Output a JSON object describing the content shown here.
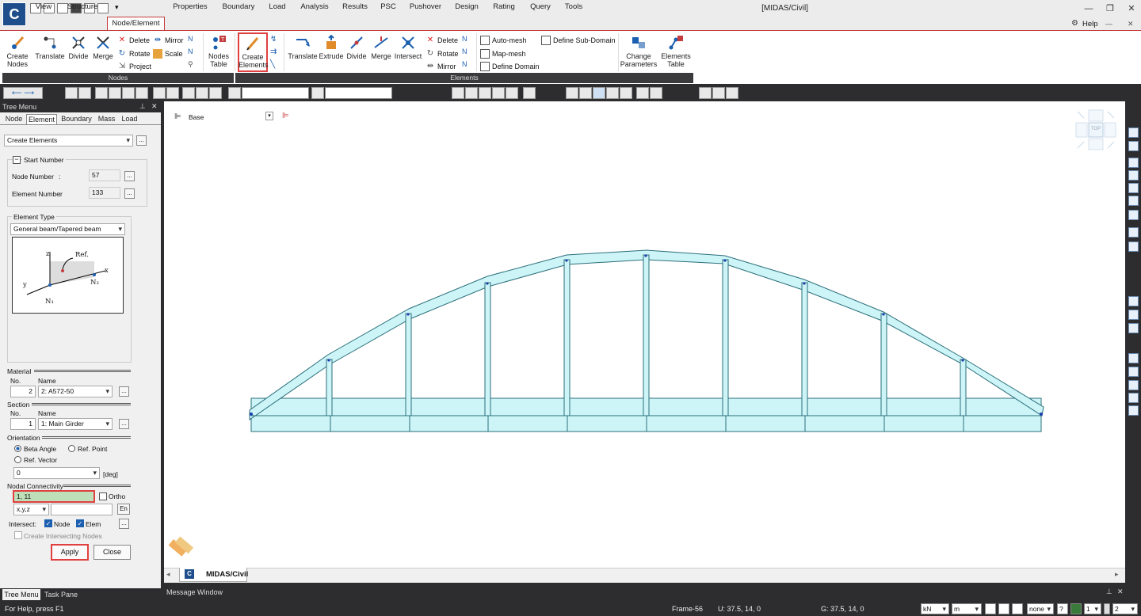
{
  "app": {
    "title": "[MIDAS/Civil]",
    "logo": "C"
  },
  "window": {
    "minimize": "—",
    "restore": "❐",
    "close": "✕"
  },
  "menu": {
    "tabs": [
      "View",
      "Structure",
      "Node/Element",
      "Properties",
      "Boundary",
      "Load",
      "Analysis",
      "Results",
      "PSC",
      "Pushover",
      "Design",
      "Rating",
      "Query",
      "Tools"
    ],
    "active": "Node/Element",
    "help": "Help"
  },
  "ribbon": {
    "nodes_group": "Nodes",
    "elements_group": "Elements",
    "create_nodes": "Create Nodes",
    "translate": "Translate",
    "divide": "Divide",
    "merge": "Merge",
    "delete": "Delete",
    "rotate": "Rotate",
    "project": "Project",
    "mirror": "Mirror",
    "scale": "Scale",
    "nodes_table": "Nodes Table",
    "create_elements": "Create Elements",
    "e_translate": "Translate",
    "extrude": "Extrude",
    "e_divide": "Divide",
    "e_merge": "Merge",
    "intersect": "Intersect",
    "e_delete": "Delete",
    "e_rotate": "Rotate",
    "e_mirror": "Mirror",
    "auto_mesh": "Auto-mesh",
    "map_mesh": "Map-mesh",
    "define_domain": "Define Domain",
    "define_sub_domain": "Define Sub-Domain",
    "change_parameters": "Change Parameters",
    "elements_table": "Elements Table"
  },
  "tree": {
    "header": "Tree Menu",
    "tabs": [
      "Node",
      "Element",
      "Boundary",
      "Mass",
      "Load"
    ],
    "active_tab": "Element",
    "command": "Create Elements",
    "start_number": "Start Number",
    "node_number_label": "Node Number",
    "node_number": "57",
    "element_number_label": "Element Number",
    "element_number": "133",
    "element_type_label": "Element Type",
    "element_type": "General beam/Tapered beam",
    "diagram": {
      "z": "z",
      "ref": "Ref.",
      "x": "x",
      "y": "y",
      "n1": "N₁",
      "n2": "N₂"
    },
    "material_label": "Material",
    "no": "No.",
    "name": "Name",
    "material_no": "2",
    "material_name": "2: A572-50",
    "section_label": "Section",
    "section_no": "1",
    "section_name": "1: Main Girder",
    "orientation_label": "Orientation",
    "beta_angle": "Beta Angle",
    "ref_point": "Ref. Point",
    "ref_vector": "Ref. Vector",
    "angle_value": "0",
    "deg": "[deg]",
    "connectivity_label": "Nodal Connectivity",
    "connectivity": "1, 11",
    "ortho": "Ortho",
    "coord": "x,y,z",
    "en": "En",
    "intersect_label": "Intersect:",
    "node": "Node",
    "elem": "Elem",
    "create_intersecting": "Create Intersecting Nodes",
    "apply": "Apply",
    "close": "Close",
    "more": "...",
    "footer_tabs": [
      "Tree Menu",
      "Task Pane"
    ]
  },
  "viewport": {
    "base_label": "Base",
    "view_tab": "MIDAS/Civil",
    "cube_label": "TOP"
  },
  "message_window": "Message Window",
  "status": {
    "help": "For Help, press F1",
    "frame": "Frame-56",
    "u": "U: 37.5, 14, 0",
    "g": "G: 37.5, 14, 0",
    "force_unit": "kN",
    "length_unit": "m",
    "none": "none",
    "page": "1",
    "count": "2"
  },
  "colors": {
    "accent": "#c43c3c",
    "model_fill": "#cdf5f8",
    "model_line": "#2a6e7a",
    "highlight": "#e04040"
  }
}
